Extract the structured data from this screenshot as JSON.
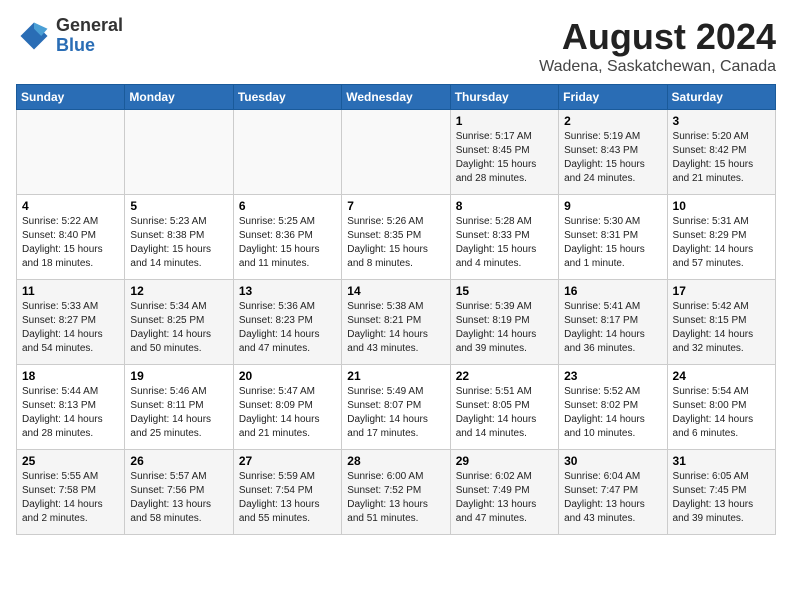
{
  "header": {
    "logo_general": "General",
    "logo_blue": "Blue",
    "month_year": "August 2024",
    "location": "Wadena, Saskatchewan, Canada"
  },
  "weekdays": [
    "Sunday",
    "Monday",
    "Tuesday",
    "Wednesday",
    "Thursday",
    "Friday",
    "Saturday"
  ],
  "weeks": [
    [
      {
        "num": "",
        "sunrise": "",
        "sunset": "",
        "daylight": ""
      },
      {
        "num": "",
        "sunrise": "",
        "sunset": "",
        "daylight": ""
      },
      {
        "num": "",
        "sunrise": "",
        "sunset": "",
        "daylight": ""
      },
      {
        "num": "",
        "sunrise": "",
        "sunset": "",
        "daylight": ""
      },
      {
        "num": "1",
        "sunrise": "Sunrise: 5:17 AM",
        "sunset": "Sunset: 8:45 PM",
        "daylight": "Daylight: 15 hours and 28 minutes."
      },
      {
        "num": "2",
        "sunrise": "Sunrise: 5:19 AM",
        "sunset": "Sunset: 8:43 PM",
        "daylight": "Daylight: 15 hours and 24 minutes."
      },
      {
        "num": "3",
        "sunrise": "Sunrise: 5:20 AM",
        "sunset": "Sunset: 8:42 PM",
        "daylight": "Daylight: 15 hours and 21 minutes."
      }
    ],
    [
      {
        "num": "4",
        "sunrise": "Sunrise: 5:22 AM",
        "sunset": "Sunset: 8:40 PM",
        "daylight": "Daylight: 15 hours and 18 minutes."
      },
      {
        "num": "5",
        "sunrise": "Sunrise: 5:23 AM",
        "sunset": "Sunset: 8:38 PM",
        "daylight": "Daylight: 15 hours and 14 minutes."
      },
      {
        "num": "6",
        "sunrise": "Sunrise: 5:25 AM",
        "sunset": "Sunset: 8:36 PM",
        "daylight": "Daylight: 15 hours and 11 minutes."
      },
      {
        "num": "7",
        "sunrise": "Sunrise: 5:26 AM",
        "sunset": "Sunset: 8:35 PM",
        "daylight": "Daylight: 15 hours and 8 minutes."
      },
      {
        "num": "8",
        "sunrise": "Sunrise: 5:28 AM",
        "sunset": "Sunset: 8:33 PM",
        "daylight": "Daylight: 15 hours and 4 minutes."
      },
      {
        "num": "9",
        "sunrise": "Sunrise: 5:30 AM",
        "sunset": "Sunset: 8:31 PM",
        "daylight": "Daylight: 15 hours and 1 minute."
      },
      {
        "num": "10",
        "sunrise": "Sunrise: 5:31 AM",
        "sunset": "Sunset: 8:29 PM",
        "daylight": "Daylight: 14 hours and 57 minutes."
      }
    ],
    [
      {
        "num": "11",
        "sunrise": "Sunrise: 5:33 AM",
        "sunset": "Sunset: 8:27 PM",
        "daylight": "Daylight: 14 hours and 54 minutes."
      },
      {
        "num": "12",
        "sunrise": "Sunrise: 5:34 AM",
        "sunset": "Sunset: 8:25 PM",
        "daylight": "Daylight: 14 hours and 50 minutes."
      },
      {
        "num": "13",
        "sunrise": "Sunrise: 5:36 AM",
        "sunset": "Sunset: 8:23 PM",
        "daylight": "Daylight: 14 hours and 47 minutes."
      },
      {
        "num": "14",
        "sunrise": "Sunrise: 5:38 AM",
        "sunset": "Sunset: 8:21 PM",
        "daylight": "Daylight: 14 hours and 43 minutes."
      },
      {
        "num": "15",
        "sunrise": "Sunrise: 5:39 AM",
        "sunset": "Sunset: 8:19 PM",
        "daylight": "Daylight: 14 hours and 39 minutes."
      },
      {
        "num": "16",
        "sunrise": "Sunrise: 5:41 AM",
        "sunset": "Sunset: 8:17 PM",
        "daylight": "Daylight: 14 hours and 36 minutes."
      },
      {
        "num": "17",
        "sunrise": "Sunrise: 5:42 AM",
        "sunset": "Sunset: 8:15 PM",
        "daylight": "Daylight: 14 hours and 32 minutes."
      }
    ],
    [
      {
        "num": "18",
        "sunrise": "Sunrise: 5:44 AM",
        "sunset": "Sunset: 8:13 PM",
        "daylight": "Daylight: 14 hours and 28 minutes."
      },
      {
        "num": "19",
        "sunrise": "Sunrise: 5:46 AM",
        "sunset": "Sunset: 8:11 PM",
        "daylight": "Daylight: 14 hours and 25 minutes."
      },
      {
        "num": "20",
        "sunrise": "Sunrise: 5:47 AM",
        "sunset": "Sunset: 8:09 PM",
        "daylight": "Daylight: 14 hours and 21 minutes."
      },
      {
        "num": "21",
        "sunrise": "Sunrise: 5:49 AM",
        "sunset": "Sunset: 8:07 PM",
        "daylight": "Daylight: 14 hours and 17 minutes."
      },
      {
        "num": "22",
        "sunrise": "Sunrise: 5:51 AM",
        "sunset": "Sunset: 8:05 PM",
        "daylight": "Daylight: 14 hours and 14 minutes."
      },
      {
        "num": "23",
        "sunrise": "Sunrise: 5:52 AM",
        "sunset": "Sunset: 8:02 PM",
        "daylight": "Daylight: 14 hours and 10 minutes."
      },
      {
        "num": "24",
        "sunrise": "Sunrise: 5:54 AM",
        "sunset": "Sunset: 8:00 PM",
        "daylight": "Daylight: 14 hours and 6 minutes."
      }
    ],
    [
      {
        "num": "25",
        "sunrise": "Sunrise: 5:55 AM",
        "sunset": "Sunset: 7:58 PM",
        "daylight": "Daylight: 14 hours and 2 minutes."
      },
      {
        "num": "26",
        "sunrise": "Sunrise: 5:57 AM",
        "sunset": "Sunset: 7:56 PM",
        "daylight": "Daylight: 13 hours and 58 minutes."
      },
      {
        "num": "27",
        "sunrise": "Sunrise: 5:59 AM",
        "sunset": "Sunset: 7:54 PM",
        "daylight": "Daylight: 13 hours and 55 minutes."
      },
      {
        "num": "28",
        "sunrise": "Sunrise: 6:00 AM",
        "sunset": "Sunset: 7:52 PM",
        "daylight": "Daylight: 13 hours and 51 minutes."
      },
      {
        "num": "29",
        "sunrise": "Sunrise: 6:02 AM",
        "sunset": "Sunset: 7:49 PM",
        "daylight": "Daylight: 13 hours and 47 minutes."
      },
      {
        "num": "30",
        "sunrise": "Sunrise: 6:04 AM",
        "sunset": "Sunset: 7:47 PM",
        "daylight": "Daylight: 13 hours and 43 minutes."
      },
      {
        "num": "31",
        "sunrise": "Sunrise: 6:05 AM",
        "sunset": "Sunset: 7:45 PM",
        "daylight": "Daylight: 13 hours and 39 minutes."
      }
    ]
  ]
}
